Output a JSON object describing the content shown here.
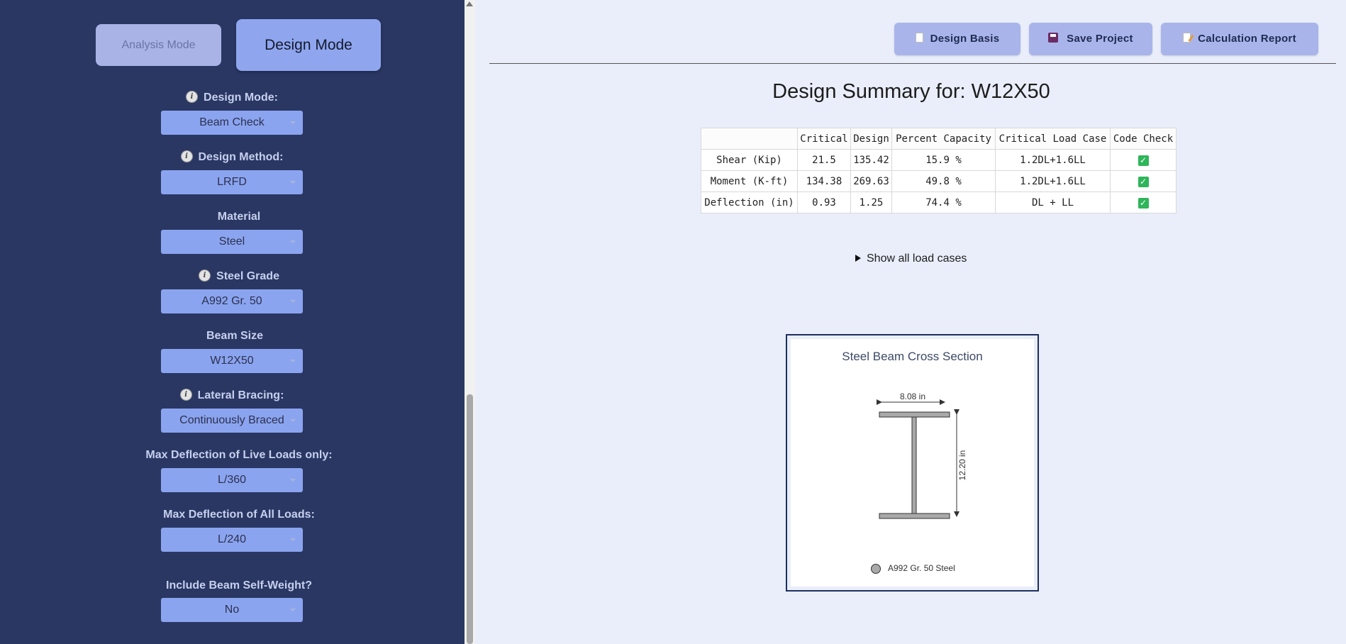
{
  "sidebar": {
    "modes": {
      "analysis": "Analysis Mode",
      "design": "Design Mode"
    },
    "fields": [
      {
        "label": "Design Mode:",
        "value": "Beam Check",
        "info": true
      },
      {
        "label": "Design Method:",
        "value": "LRFD",
        "info": true
      },
      {
        "label": "Material",
        "value": "Steel",
        "info": false
      },
      {
        "label": "Steel Grade",
        "value": "A992 Gr. 50",
        "info": true
      },
      {
        "label": "Beam Size",
        "value": "W12X50",
        "info": false
      },
      {
        "label": "Lateral Bracing:",
        "value": "Continuously Braced",
        "info": true
      },
      {
        "label": "Max Deflection of Live Loads only:",
        "value": "L/360",
        "info": false
      },
      {
        "label": "Max Deflection of All Loads:",
        "value": "L/240",
        "info": false
      },
      {
        "label": "Include Beam Self-Weight?",
        "value": "No",
        "info": false
      }
    ]
  },
  "toolbar": {
    "design_basis": "Design Basis",
    "save_project": "Save Project",
    "calculation_report": "Calculation Report"
  },
  "summary": {
    "title": "Design Summary for: W12X50",
    "columns": [
      "",
      "Critical",
      "Design",
      "Percent Capacity",
      "Critical Load Case",
      "Code Check"
    ],
    "rows": [
      {
        "name": "Shear (Kip)",
        "critical": "21.5",
        "design": "135.42",
        "percent": "15.9 %",
        "load_case": "1.2DL+1.6LL",
        "check": "✓"
      },
      {
        "name": "Moment (K-ft)",
        "critical": "134.38",
        "design": "269.63",
        "percent": "49.8 %",
        "load_case": "1.2DL+1.6LL",
        "check": "✓"
      },
      {
        "name": "Deflection (in)",
        "critical": "0.93",
        "design": "1.25",
        "percent": "74.4 %",
        "load_case": "DL + LL",
        "check": "✓"
      }
    ],
    "show_all": "Show all load cases"
  },
  "figure": {
    "title": "Steel Beam Cross Section",
    "width_label": "8.08 in",
    "depth_label": "12.20 in",
    "legend": "A992 Gr. 50 Steel"
  },
  "colors": {
    "sidebar_bg": "#2a3763",
    "button_accent": "#8ba4ef",
    "check_green": "#2fb55a"
  }
}
